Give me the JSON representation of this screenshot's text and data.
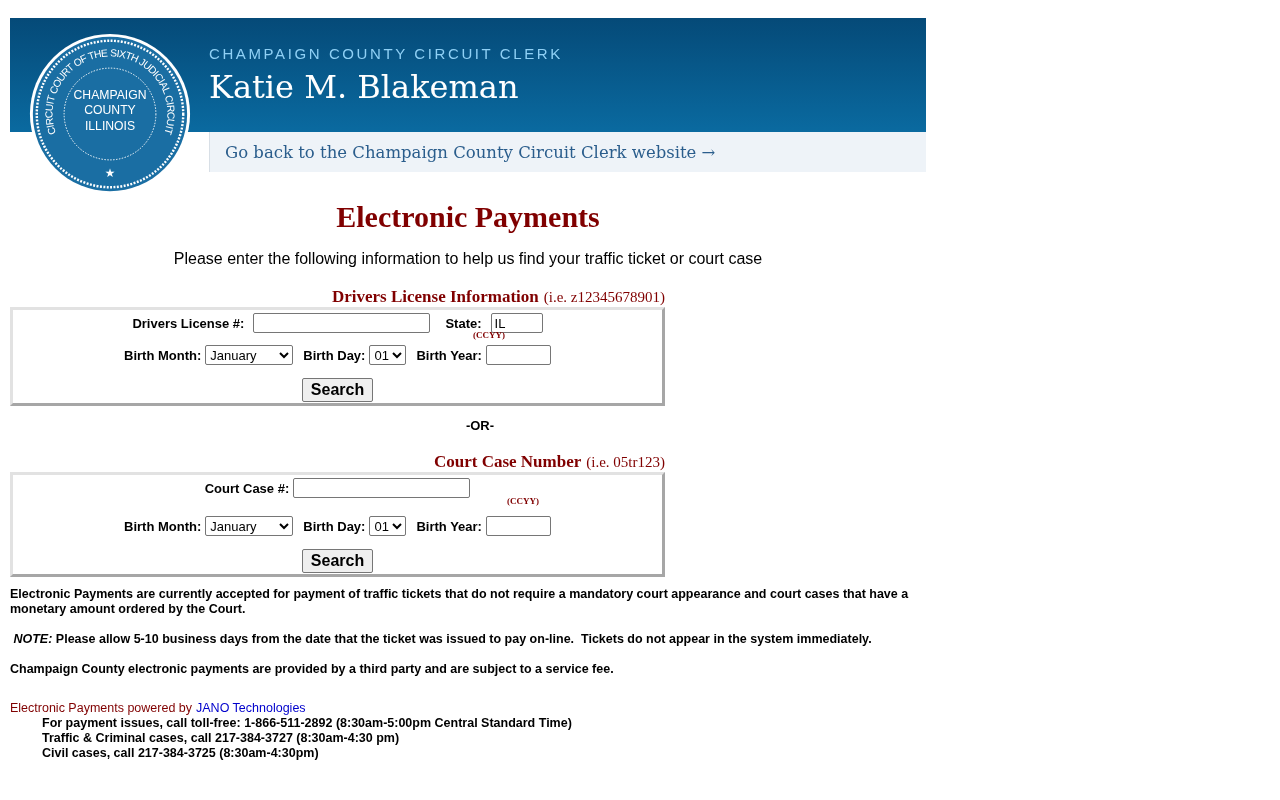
{
  "header": {
    "agency": "CHAMPAIGN COUNTY CIRCUIT CLERK",
    "clerk_name": "Katie M. Blakeman",
    "back_link": "Go back to the Champaign County Circuit Clerk website →",
    "seal": {
      "ring_text": "CIRCUIT COURT OF THE SIXTH JUDICIAL CIRCUIT",
      "center_lines": [
        "CHAMPAIGN",
        "COUNTY",
        "ILLINOIS"
      ],
      "star": "★"
    }
  },
  "title": "Electronic Payments",
  "intro": "Please enter the following information to help us find your traffic ticket or court case",
  "forms": [
    {
      "heading": "Drivers License Information",
      "example": "(i.e. z12345678901)",
      "fields": [
        {
          "label": "Drivers License #:"
        },
        {
          "label": "State:",
          "value": "IL"
        }
      ],
      "birth": {
        "month_label": "Birth Month:",
        "month": "January",
        "day_label": "Birth Day:",
        "day": "01",
        "year_label": "Birth Year:",
        "year_hint": "(CCYY)"
      },
      "button": "Search"
    },
    {
      "heading": "Court Case Number",
      "example": "(i.e. 05tr123)",
      "fields": [
        {
          "label": "Court Case #:"
        }
      ],
      "birth": {
        "month_label": "Birth Month:",
        "month": "January",
        "day_label": "Birth Day:",
        "day": "01",
        "year_label": "Birth Year:",
        "year_hint": "(CCYY)"
      },
      "button": "Search"
    }
  ],
  "separator": "-OR-",
  "notes": [
    "Electronic Payments are currently accepted for payment of traffic tickets that do not require a mandatory court appearance and court cases that have a monetary amount ordered by the Court.",
    " *NOTE:* Please allow 5-10 business days from the date that the ticket was issued to pay on-line.  Tickets do not appear in the system immediately.",
    "Champaign County electronic payments are provided by a third party and are subject to a service fee."
  ],
  "footer": {
    "powered_by": "Electronic Payments powered by",
    "vendor": "JANO Technologies",
    "contacts": [
      "For payment issues, call toll-free: 1-866-511-2892 (8:30am-5:00pm Central Standard Time)",
      "Traffic & Criminal cases, call 217-384-3727 (8:30am-4:30 pm)",
      "Civil cases, call 217-384-3725 (8:30am-4:30pm)"
    ]
  }
}
